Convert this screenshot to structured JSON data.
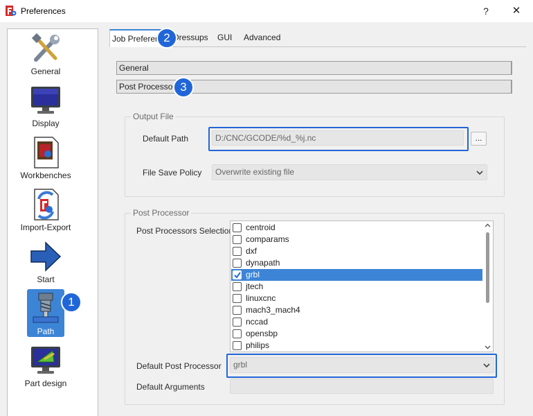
{
  "window": {
    "title": "Preferences",
    "help_label": "?",
    "close_label": "✕"
  },
  "sidebar": {
    "items": [
      {
        "label": "General",
        "icon": "tools-icon"
      },
      {
        "label": "Display",
        "icon": "monitor-icon"
      },
      {
        "label": "Workbenches",
        "icon": "workbench-icon"
      },
      {
        "label": "Import-Export",
        "icon": "import-export-icon"
      },
      {
        "label": "Start",
        "icon": "arrow-right-icon"
      },
      {
        "label": "Path",
        "icon": "path-mill-icon",
        "selected": true
      },
      {
        "label": "Part design",
        "icon": "part-design-icon"
      }
    ]
  },
  "tabs": [
    {
      "label": "Job Preferences",
      "active": true
    },
    {
      "label": "Dressups"
    },
    {
      "label": "GUI"
    },
    {
      "label": "Advanced"
    }
  ],
  "sections": {
    "general_label": "General",
    "post_processor_label": "Post Processor"
  },
  "output_file": {
    "group_title": "Output File",
    "default_path_label": "Default Path",
    "default_path_value": "D:/CNC/GCODE/%d_%j.nc",
    "browse_label": "...",
    "save_policy_label": "File Save Policy",
    "save_policy_value": "Overwrite existing file"
  },
  "post_processor": {
    "group_title": "Post Processor",
    "selection_label": "Post Processors Selection",
    "items": [
      {
        "label": "centroid",
        "checked": false
      },
      {
        "label": "comparams",
        "checked": false
      },
      {
        "label": "dxf",
        "checked": false
      },
      {
        "label": "dynapath",
        "checked": false
      },
      {
        "label": "grbl",
        "checked": true
      },
      {
        "label": "jtech",
        "checked": false
      },
      {
        "label": "linuxcnc",
        "checked": false
      },
      {
        "label": "mach3_mach4",
        "checked": false
      },
      {
        "label": "nccad",
        "checked": false
      },
      {
        "label": "opensbp",
        "checked": false
      },
      {
        "label": "philips",
        "checked": false
      }
    ],
    "default_label": "Default Post Processor",
    "default_value": "grbl",
    "arguments_label": "Default Arguments",
    "arguments_value": ""
  },
  "annotations": [
    "1",
    "2",
    "3"
  ],
  "colors": {
    "accent": "#3c84d6",
    "callout": "#2166d8"
  }
}
